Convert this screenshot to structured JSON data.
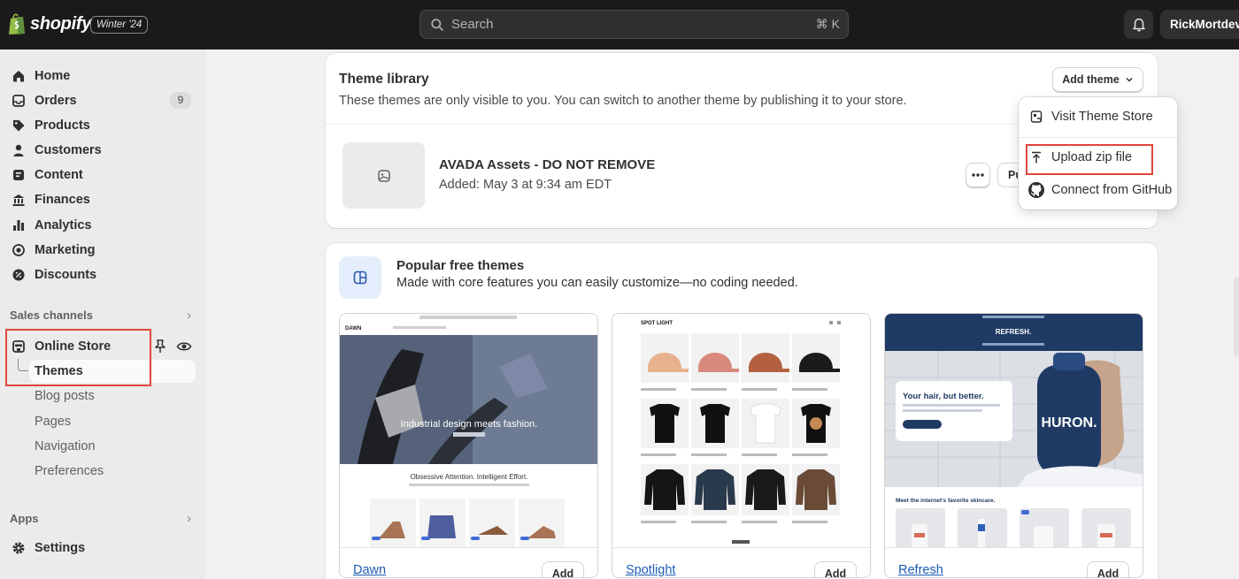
{
  "topbar": {
    "brand": "shopify",
    "edition": "Winter '24",
    "search_placeholder": "Search",
    "search_shortcut": "⌘ K",
    "user": "RickMortdev"
  },
  "sidebar": {
    "items": [
      {
        "label": "Home",
        "icon": "home-icon"
      },
      {
        "label": "Orders",
        "icon": "inbox-icon",
        "badge": "9"
      },
      {
        "label": "Products",
        "icon": "tag-icon"
      },
      {
        "label": "Customers",
        "icon": "person-icon"
      },
      {
        "label": "Content",
        "icon": "content-icon"
      },
      {
        "label": "Finances",
        "icon": "bank-icon"
      },
      {
        "label": "Analytics",
        "icon": "chart-icon"
      },
      {
        "label": "Marketing",
        "icon": "target-icon"
      },
      {
        "label": "Discounts",
        "icon": "discount-icon"
      }
    ],
    "sales_channels_label": "Sales channels",
    "online_store_label": "Online Store",
    "online_store_sub": [
      "Themes",
      "Blog posts",
      "Pages",
      "Navigation",
      "Preferences"
    ],
    "apps_label": "Apps",
    "settings_label": "Settings"
  },
  "library": {
    "title": "Theme library",
    "subtitle": "These themes are only visible to you. You can switch to another theme by publishing it to your store.",
    "add_theme_label": "Add theme",
    "asset_name": "AVADA Assets - DO NOT REMOVE",
    "asset_added": "Added: May 3 at 9:34 am EDT",
    "publish_label": "Publish"
  },
  "dropdown": {
    "items": [
      "Visit Theme Store",
      "Upload zip file",
      "Connect from GitHub"
    ]
  },
  "popular": {
    "title": "Popular free themes",
    "subtitle": "Made with core features you can easily customize—no coding needed.",
    "themes": [
      {
        "name": "Dawn",
        "add_label": "Add",
        "brand": "DAWN",
        "hero": "Industrial design meets fashion.",
        "tagline": "Obsessive Attention. Intelligent Effort."
      },
      {
        "name": "Spotlight",
        "add_label": "Add",
        "brand": "SPOT LIGHT"
      },
      {
        "name": "Refresh",
        "add_label": "Add",
        "brand": "REFRESH.",
        "hero": "Your hair, but better.",
        "product": "HURON.",
        "section": "Meet the internet's favorite skincare."
      }
    ]
  },
  "colors": {
    "topbar": "#1a1a1a",
    "highlight": "#e0463b",
    "link": "#1e5db3",
    "refresh_navy": "#1f3a64"
  }
}
